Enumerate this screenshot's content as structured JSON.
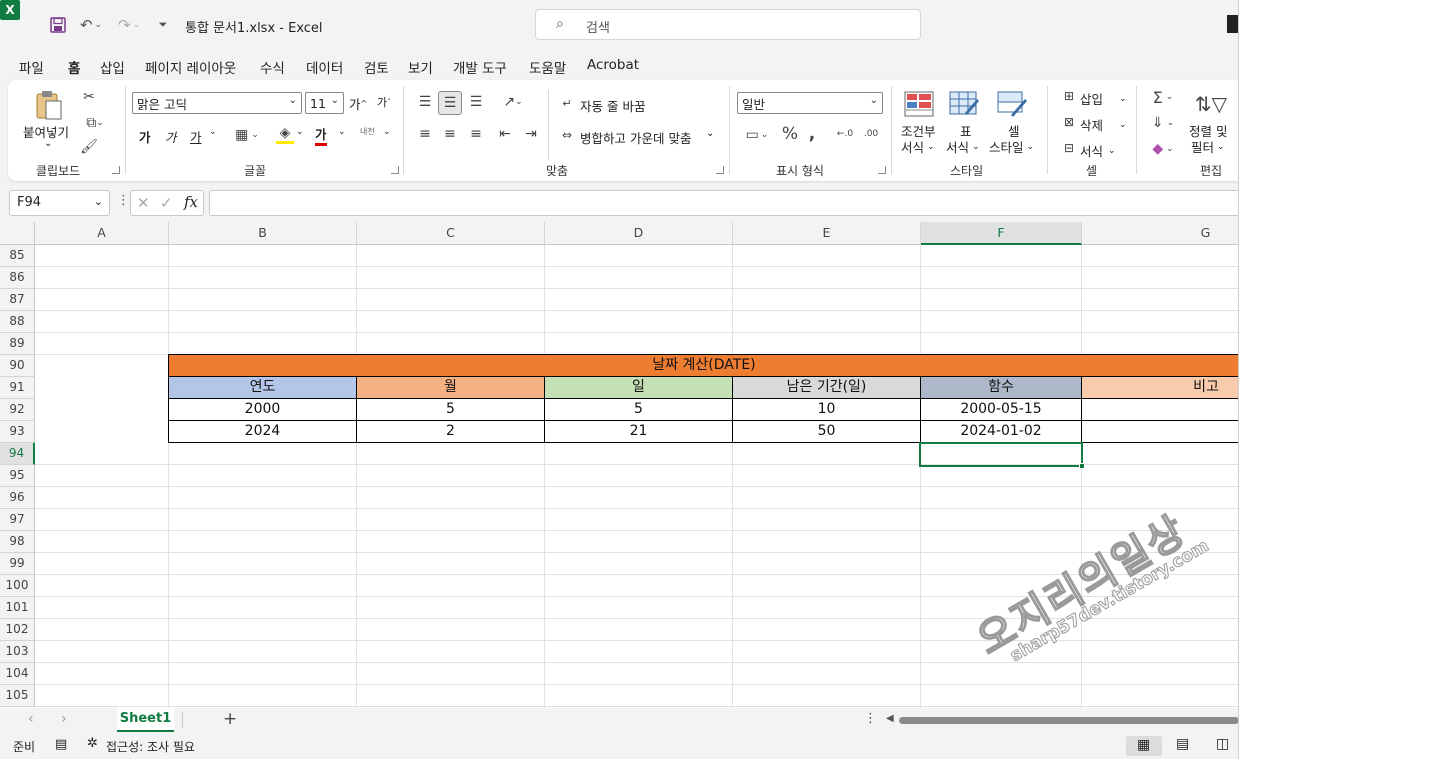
{
  "titlebar": {
    "doc_title": "통합 문서1.xlsx  -  Excel",
    "search_placeholder": "검색",
    "icons": [
      "excel-logo",
      "save-icon",
      "undo-icon",
      "redo-icon",
      "customize-qat-icon",
      "search-icon"
    ]
  },
  "menu": {
    "tabs": [
      "파일",
      "홈",
      "삽입",
      "페이지 레이아웃",
      "수식",
      "데이터",
      "검토",
      "보기",
      "개발 도구",
      "도움말",
      "Acrobat"
    ],
    "active": "홈"
  },
  "ribbon": {
    "clipboard": {
      "label": "클립보드",
      "paste": "붙여넣기"
    },
    "font": {
      "label": "글꼴",
      "font_name": "맑은 고딕",
      "font_size": "11",
      "bold": "가",
      "italic": "가",
      "underline": "가",
      "font_color_glyph": "가",
      "grow": "가",
      "shrink": "가",
      "phonetic": "내천"
    },
    "alignment": {
      "label": "맞춤",
      "wrap_text": "자동 줄 바꿈",
      "merge_center": "병합하고 가운데 맞춤"
    },
    "number": {
      "label": "표시 형식",
      "format": "일반"
    },
    "styles": {
      "label": "스타일",
      "conditional_1": "조건부",
      "conditional_2": "서식",
      "table_1": "표",
      "table_2": "서식",
      "cell_1": "셀",
      "cell_2": "스타일"
    },
    "cells": {
      "label": "셀",
      "insert": "삽입",
      "delete": "삭제",
      "format": "서식"
    },
    "editing": {
      "label": "편집",
      "sort_1": "정렬 및",
      "sort_2": "필터"
    }
  },
  "formula_bar": {
    "name_box": "F94",
    "fx": "fx",
    "formula": ""
  },
  "grid": {
    "columns": [
      "A",
      "B",
      "C",
      "D",
      "E",
      "F",
      "G"
    ],
    "selected_column": "F",
    "rows": [
      "85",
      "86",
      "87",
      "88",
      "89",
      "90",
      "91",
      "92",
      "93",
      "94",
      "95",
      "96",
      "97",
      "98",
      "99",
      "100",
      "101",
      "102",
      "103",
      "104",
      "105"
    ],
    "selected_row": "94"
  },
  "table": {
    "title": "날짜 계산(DATE)",
    "headers": [
      "연도",
      "월",
      "일",
      "남은 기간(일)",
      "함수",
      "비고"
    ],
    "header_colors": [
      "#b4c6e7",
      "#f4b183",
      "#c5e0b4",
      "#d9d9d9",
      "#adb9ca",
      "#f8cbad"
    ],
    "title_color": "#ed7d31",
    "rows": [
      [
        "2000",
        "5",
        "5",
        "10",
        "2000-05-15",
        ""
      ],
      [
        "2024",
        "2",
        "21",
        "50",
        "2024-01-02",
        ""
      ]
    ]
  },
  "watermark": {
    "main": "오지리의일상",
    "sub": "sharp57dev.tistory.com"
  },
  "sheets": {
    "tabs": [
      "Sheet1"
    ],
    "active": "Sheet1",
    "add": "+"
  },
  "status": {
    "ready": "준비",
    "accessibility": "접근성: 조사 필요"
  },
  "colors": {
    "accent": "#107c41"
  }
}
